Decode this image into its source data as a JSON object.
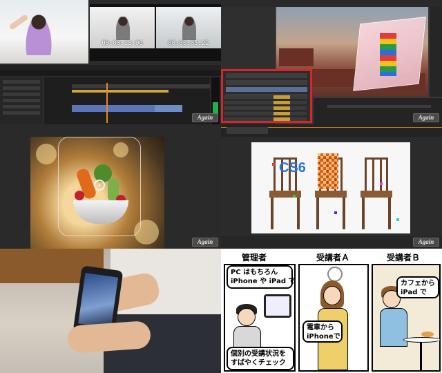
{
  "panel1": {
    "program_timecode_left": "00:00:13:06",
    "program_timecode_right": "00:00:05:22",
    "watermark": "Again"
  },
  "panel2": {
    "watermark": "Again"
  },
  "panel3": {
    "watermark": "Again"
  },
  "panel4": {
    "overlay_text": "CS6",
    "watermark": "Again"
  },
  "panel6": {
    "role_admin": "管理者",
    "role_a": "受講者Ａ",
    "role_b": "受講者Ｂ",
    "admin_bubble": "PC はもちろん\niPhone や iPad で",
    "admin_caption": "個別の受講状況を\nすばやくチェック",
    "a_bubble": "電車から\niPhoneで",
    "b_bubble": "カフェから\niPad で"
  },
  "colors": {
    "highlight_frame": "#d4262b",
    "playhead": "#e08b2a",
    "cs6_text": "#2b72d8"
  }
}
